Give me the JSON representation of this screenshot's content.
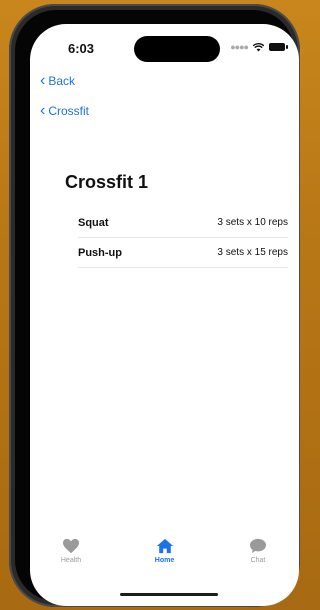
{
  "status": {
    "time": "6:03"
  },
  "nav": {
    "back_label": "Back",
    "parent_label": "Crossfit"
  },
  "workout": {
    "title": "Crossfit 1",
    "exercises": [
      {
        "name": "Squat",
        "detail": "3 sets  x  10 reps"
      },
      {
        "name": "Push-up",
        "detail": "3 sets  x  15 reps"
      }
    ]
  },
  "tabs": [
    {
      "label": "Health",
      "icon": "heart-icon",
      "active": false
    },
    {
      "label": "Home",
      "icon": "home-icon",
      "active": true
    },
    {
      "label": "Chat",
      "icon": "chat-bubble-icon",
      "active": false
    }
  ],
  "colors": {
    "accent": "#1a73e8",
    "inactive": "#9a9a9a"
  }
}
